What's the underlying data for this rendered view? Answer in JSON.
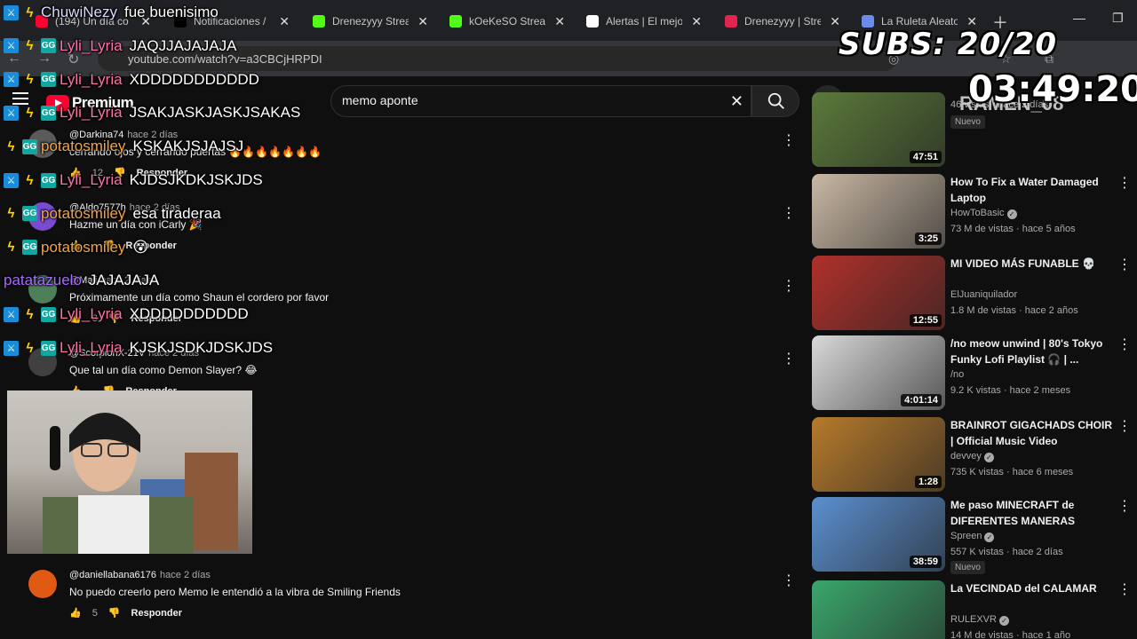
{
  "browser": {
    "tabs": [
      {
        "title": "(194) Un día co",
        "icon": "youtube-icon",
        "color": "#ff0033"
      },
      {
        "title": "Notificaciones /",
        "icon": "x-icon",
        "color": "#000000"
      },
      {
        "title": "Drenezyyy Strea",
        "icon": "kick-icon",
        "color": "#53fc18"
      },
      {
        "title": "kOeKeSO Strean",
        "icon": "kick-icon",
        "color": "#53fc18"
      },
      {
        "title": "Alertas | El mejo",
        "icon": "alert-icon",
        "color": "#ffffff"
      },
      {
        "title": "Drenezyyy | Stre",
        "icon": "streamer-icon",
        "color": "#e0264e"
      },
      {
        "title": "La Ruleta Aleato",
        "icon": "globe-icon",
        "color": "#6b8ce8"
      }
    ],
    "url": "youtube.com/watch?v=a3CBCjHRPDI"
  },
  "youtube": {
    "logo_text": "Premium",
    "search_value": "memo aponte"
  },
  "comments": [
    {
      "user": "@Darkina74",
      "time": "hace 2 días",
      "text": "cerrando ojos y cerrando puertas 🔥🔥🔥🔥🔥🔥🔥",
      "likes": "12",
      "reply": "Responder",
      "avatar_color": "#5a5a5a"
    },
    {
      "user": "@Aldo7577h",
      "time": "hace 2 días",
      "text": "Hazme un día con iCarly 🎉",
      "likes": "",
      "reply": "Responder",
      "avatar_color": "#7a4bd1"
    },
    {
      "user": "@Mali",
      "time": "hace 2 días",
      "text": "Próximamente un día como Shaun el cordero por favor",
      "likes": "3",
      "reply": "Responder",
      "avatar_color": "#4d7f5a"
    },
    {
      "user": "@ScorpionX-21V",
      "time": "hace 2 días",
      "text": "Que tal un día como Demon Slayer? 😂",
      "likes": "",
      "reply": "Responder",
      "avatar_color": "#404040"
    },
    {
      "user": "@daniellabana6176",
      "time": "hace 2 días",
      "text": "No puedo creerlo pero Memo le entendió a la vibra de Smiling Friends",
      "likes": "5",
      "reply": "Responder",
      "avatar_color": "#e05a14"
    }
  ],
  "videos": [
    {
      "title": "",
      "channel": "",
      "stats": "46 vistas · hace 2 días",
      "duration": "47:51",
      "badge": "Nuevo",
      "thumb": "#5b7a3a"
    },
    {
      "title": "How To Fix a Water Damaged Laptop",
      "channel": "HowToBasic",
      "verified": true,
      "stats": "73 M de vistas · hace 5 años",
      "duration": "3:25",
      "badge": "",
      "thumb": "#c9b8a4"
    },
    {
      "title": "MI VIDEO MÁS FUNABLE 💀",
      "channel": "ElJuaniquilador",
      "verified": false,
      "stats": "1.8 M de vistas · hace 2 años",
      "duration": "12:55",
      "badge": "",
      "thumb": "#b0302a"
    },
    {
      "title": "/no meow unwind | 80's Tokyo Funky Lofi Playlist 🎧 | ...",
      "channel": "/no",
      "verified": false,
      "stats": "9.2 K vistas · hace 2 meses",
      "duration": "4:01:14",
      "badge": "",
      "thumb": "#d9d9d9"
    },
    {
      "title": "BRAINROT GIGACHADS CHOIR | Official Music Video",
      "channel": "devvey",
      "verified": true,
      "stats": "735 K vistas · hace 6 meses",
      "duration": "1:28",
      "badge": "",
      "thumb": "#b67a2c"
    },
    {
      "title": "Me paso MINECRAFT de DIFERENTES MANERAS",
      "channel": "Spreen",
      "verified": true,
      "stats": "557 K vistas · hace 2 días",
      "duration": "38:59",
      "badge": "Nuevo",
      "thumb": "#5b8fcf"
    },
    {
      "title": "La VECINDAD del CALAMAR",
      "channel": "RULEXVR",
      "verified": true,
      "stats": "14 M de vistas · hace 1 año",
      "duration": "",
      "badge": "",
      "thumb": "#3aa66b"
    }
  ],
  "chat": [
    {
      "user": "ChuwiNezy",
      "color": "#d8d8ff",
      "msg": "fue buenisimo",
      "badges": [
        "mod",
        "prime"
      ]
    },
    {
      "user": "Lyli_Lyria",
      "color": "#ff6fa8",
      "msg": "JAQJJAJAJAJA",
      "badges": [
        "mod",
        "prime",
        "sub"
      ]
    },
    {
      "user": "Lyli_Lyria",
      "color": "#ff6fa8",
      "msg": "XDDDDDDDDDDD",
      "badges": [
        "mod",
        "prime",
        "sub"
      ]
    },
    {
      "user": "Lyli_Lyria",
      "color": "#ff6fa8",
      "msg": "JSAKJASKJASKJSAKAS",
      "badges": [
        "mod",
        "prime",
        "sub"
      ]
    },
    {
      "user": "potatosmiley",
      "color": "#f7a440",
      "msg": "KSKAKJSJAJSJ",
      "badges": [
        "prime",
        "sub"
      ]
    },
    {
      "user": "Lyli_Lyria",
      "color": "#ff6fa8",
      "msg": "KJDSJKDKJSKJDS",
      "badges": [
        "mod",
        "prime",
        "sub"
      ]
    },
    {
      "user": "potatosmiley",
      "color": "#f7a440",
      "msg": "esa tiraderaa",
      "badges": [
        "prime",
        "sub"
      ]
    },
    {
      "user": "potatosmiley",
      "color": "#f7a440",
      "msg": "😵",
      "badges": [
        "prime",
        "sub"
      ]
    },
    {
      "user": "patatazuelo",
      "color": "#a86bff",
      "msg": "JAJAJAJA",
      "badges": []
    },
    {
      "user": "Lyli_Lyria",
      "color": "#ff6fa8",
      "msg": "XDDDDDDDDDD",
      "badges": [
        "mod",
        "prime",
        "sub"
      ]
    },
    {
      "user": "Lyli_Lyria",
      "color": "#ff6fa8",
      "msg": "KJSKJSDKJDSKJDS",
      "badges": [
        "mod",
        "prime",
        "sub"
      ]
    }
  ],
  "overlay": {
    "subs": "SUBS: 20/20",
    "timer": "03:49:20",
    "label": "RAMEN_08"
  },
  "colors": {
    "bg": "#0f0f0f",
    "text": "#f1f1f1",
    "muted": "#aaaaaa",
    "brand": "#ff0033"
  }
}
